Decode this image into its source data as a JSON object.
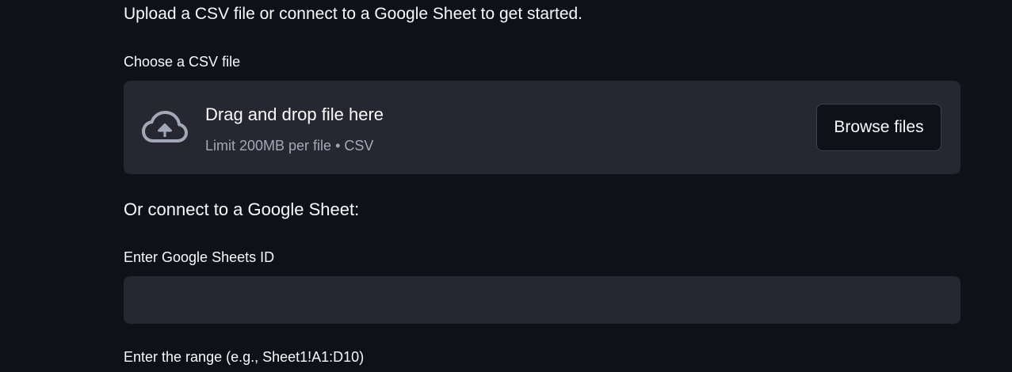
{
  "intro_text": "Upload a CSV file or connect to a Google Sheet to get started.",
  "csv_uploader": {
    "label": "Choose a CSV file",
    "icon": "cloud-upload-icon",
    "drop_title": "Drag and drop file here",
    "drop_subtitle": "Limit 200MB per file • CSV",
    "browse_label": "Browse files"
  },
  "google_sheet": {
    "heading": "Or connect to a Google Sheet:",
    "sheet_id_label": "Enter Google Sheets ID",
    "sheet_id_value": "",
    "range_label": "Enter the range (e.g., Sheet1!A1:D10)"
  },
  "colors": {
    "background": "#0e1117",
    "panel": "#262730",
    "text": "#fafafa",
    "muted_text": "#a3a8b8"
  }
}
